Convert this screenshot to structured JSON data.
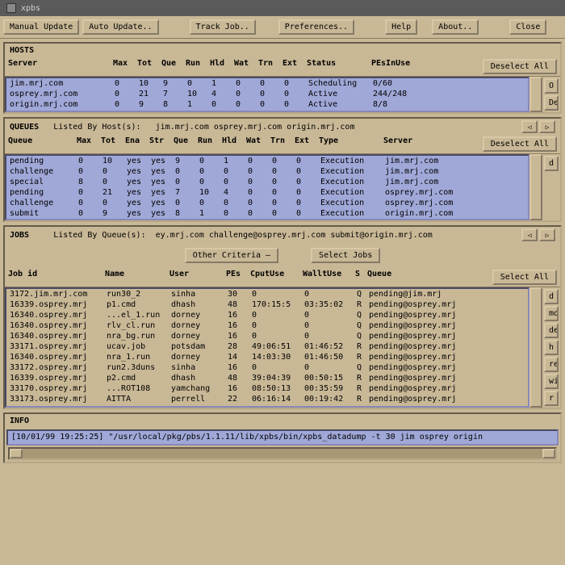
{
  "window": {
    "title": "xpbs"
  },
  "menu": {
    "manual_update": "Manual Update",
    "auto_update": "Auto Update..",
    "track_job": "Track Job..",
    "preferences": "Preferences..",
    "help": "Help",
    "about": "About..",
    "close": "Close"
  },
  "hosts": {
    "title": "HOSTS",
    "deselect": "Deselect All",
    "headers": [
      "Server",
      "Max",
      "Tot",
      "Que",
      "Run",
      "Hld",
      "Wat",
      "Trn",
      "Ext",
      "Status",
      "PEsInUse"
    ],
    "rows": [
      {
        "server": "jim.mrj.com",
        "max": "0",
        "tot": "10",
        "que": "9",
        "run": "0",
        "hld": "1",
        "wat": "0",
        "trn": "0",
        "ext": "0",
        "status": "Scheduling",
        "peinuse": "0/60"
      },
      {
        "server": "osprey.mrj.com",
        "max": "0",
        "tot": "21",
        "que": "7",
        "run": "10",
        "hld": "4",
        "wat": "0",
        "trn": "0",
        "ext": "0",
        "status": "Active",
        "peinuse": "244/248"
      },
      {
        "server": "origin.mrj.com",
        "max": "0",
        "tot": "9",
        "que": "8",
        "run": "1",
        "hld": "0",
        "wat": "0",
        "trn": "0",
        "ext": "0",
        "status": "Active",
        "peinuse": "8/8"
      }
    ]
  },
  "queues": {
    "title": "QUEUES",
    "listed_by": "Listed By Host(s):",
    "hosts_list": "jim.mrj.com   osprey.mrj.com   origin.mrj.com",
    "deselect": "Deselect All",
    "headers": [
      "Queue",
      "Max",
      "Tot",
      "Ena",
      "Str",
      "Que",
      "Run",
      "Hld",
      "Wat",
      "Trn",
      "Ext",
      "Type",
      "Server"
    ],
    "rows": [
      {
        "queue": "pending",
        "max": "0",
        "tot": "10",
        "ena": "yes",
        "str": "yes",
        "que": "9",
        "run": "0",
        "hld": "1",
        "wat": "0",
        "trn": "0",
        "ext": "0",
        "type": "Execution",
        "server": "jim.mrj.com"
      },
      {
        "queue": "challenge",
        "max": "0",
        "tot": "0",
        "ena": "yes",
        "str": "yes",
        "que": "0",
        "run": "0",
        "hld": "0",
        "wat": "0",
        "trn": "0",
        "ext": "0",
        "type": "Execution",
        "server": "jim.mrj.com"
      },
      {
        "queue": "special",
        "max": "8",
        "tot": "0",
        "ena": "yes",
        "str": "yes",
        "que": "0",
        "run": "0",
        "hld": "0",
        "wat": "0",
        "trn": "0",
        "ext": "0",
        "type": "Execution",
        "server": "jim.mrj.com"
      },
      {
        "queue": "pending",
        "max": "0",
        "tot": "21",
        "ena": "yes",
        "str": "yes",
        "que": "7",
        "run": "10",
        "hld": "4",
        "wat": "0",
        "trn": "0",
        "ext": "0",
        "type": "Execution",
        "server": "osprey.mrj.com"
      },
      {
        "queue": "challenge",
        "max": "0",
        "tot": "0",
        "ena": "yes",
        "str": "yes",
        "que": "0",
        "run": "0",
        "hld": "0",
        "wat": "0",
        "trn": "0",
        "ext": "0",
        "type": "Execution",
        "server": "osprey.mrj.com"
      },
      {
        "queue": "submit",
        "max": "0",
        "tot": "9",
        "ena": "yes",
        "str": "yes",
        "que": "8",
        "run": "1",
        "hld": "0",
        "wat": "0",
        "trn": "0",
        "ext": "0",
        "type": "Execution",
        "server": "origin.mrj.com"
      }
    ],
    "right_btn": "d"
  },
  "jobs": {
    "title": "JOBS",
    "listed_by": "Listed By Queue(s):",
    "queues_list": "ey.mrj.com   challenge@osprey.mrj.com   submit@origin.mrj.com",
    "other_criteria": "Other Criteria  —",
    "select_jobs": "Select Jobs",
    "select_all": "Select All",
    "headers": [
      "Job id",
      "Name",
      "User",
      "PEs",
      "CputUse",
      "WalltUse",
      "S",
      "Queue"
    ],
    "rows": [
      {
        "jobid": "3172.jim.mrj.com",
        "name": "run30_2",
        "user": "sinha",
        "pes": "30",
        "cput": "0",
        "wallt": "0",
        "s": "Q",
        "queue": "pending@jim.mrj"
      },
      {
        "jobid": "16339.osprey.mrj",
        "name": "p1.cmd",
        "user": "dhash",
        "pes": "48",
        "cput": "170:15:5",
        "wallt": "03:35:02",
        "s": "R",
        "queue": "pending@osprey.mrj"
      },
      {
        "jobid": "16340.osprey.mrj",
        "name": "...el_1.run",
        "user": "dorney",
        "pes": "16",
        "cput": "0",
        "wallt": "0",
        "s": "Q",
        "queue": "pending@osprey.mrj"
      },
      {
        "jobid": "16340.osprey.mrj",
        "name": "rlv_cl.run",
        "user": "dorney",
        "pes": "16",
        "cput": "0",
        "wallt": "0",
        "s": "Q",
        "queue": "pending@osprey.mrj"
      },
      {
        "jobid": "16340.osprey.mrj",
        "name": "nra_bg.run",
        "user": "dorney",
        "pes": "16",
        "cput": "0",
        "wallt": "0",
        "s": "Q",
        "queue": "pending@osprey.mrj"
      },
      {
        "jobid": "33171.osprey.mrj",
        "name": "ucav.job",
        "user": "potsdam",
        "pes": "28",
        "cput": "49:06:51",
        "wallt": "01:46:52",
        "s": "R",
        "queue": "pending@osprey.mrj"
      },
      {
        "jobid": "16340.osprey.mrj",
        "name": "nra_1.run",
        "user": "dorney",
        "pes": "14",
        "cput": "14:03:30",
        "wallt": "01:46:50",
        "s": "R",
        "queue": "pending@osprey.mrj"
      },
      {
        "jobid": "33172.osprey.mrj",
        "name": "run2.3duns",
        "user": "sinha",
        "pes": "16",
        "cput": "0",
        "wallt": "0",
        "s": "Q",
        "queue": "pending@osprey.mrj"
      },
      {
        "jobid": "16339.osprey.mrj",
        "name": "p2.cmd",
        "user": "dhash",
        "pes": "48",
        "cput": "39:04:39",
        "wallt": "00:50:15",
        "s": "R",
        "queue": "pending@osprey.mrj"
      },
      {
        "jobid": "33170.osprey.mrj",
        "name": "...ROT108",
        "user": "yamchang",
        "pes": "16",
        "cput": "08:50:13",
        "wallt": "00:35:59",
        "s": "R",
        "queue": "pending@osprey.mrj"
      },
      {
        "jobid": "33173.osprey.mrj",
        "name": "AITTA",
        "user": "perrell",
        "pes": "22",
        "cput": "06:16:14",
        "wallt": "00:19:42",
        "s": "R",
        "queue": "pending@osprey.mrj"
      }
    ],
    "right_btns": [
      "d",
      "mo",
      "de",
      "h",
      "rel",
      "wi",
      "r"
    ]
  },
  "info": {
    "title": "INFO",
    "text": "[10/01/99 19:25:25] \"/usr/local/pkg/pbs/1.1.11/lib/xpbs/bin/xpbs_datadump -t 30 jim osprey origin"
  },
  "right_panel_btns": [
    "O",
    "De"
  ]
}
